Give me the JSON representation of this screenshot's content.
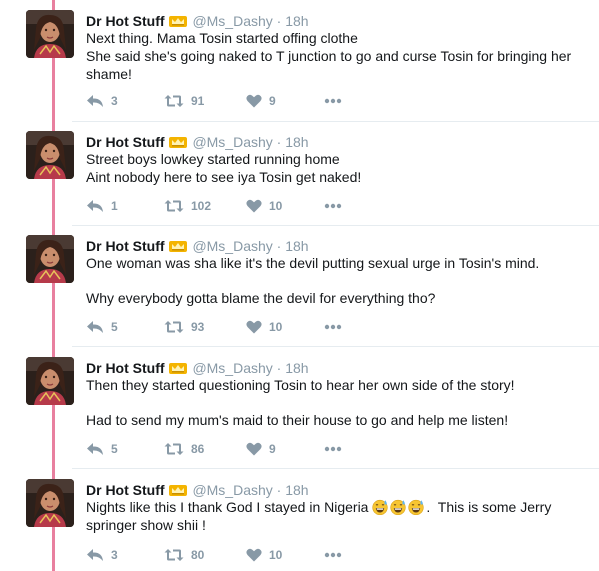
{
  "tweets": [
    {
      "name": "Dr Hot Stuff",
      "handle": "@Ms_Dashy",
      "time": "18h",
      "separator": "·",
      "lines": [
        "Next thing. Mama Tosin started offing clothe",
        "She said she's going naked to T junction to go and curse Tosin for bringing her",
        "shame!"
      ],
      "replies": "3",
      "retweets": "91",
      "likes": "9"
    },
    {
      "name": "Dr Hot Stuff",
      "handle": "@Ms_Dashy",
      "time": "18h",
      "separator": "·",
      "lines": [
        "Street boys lowkey started running home",
        "Aint nobody here to see iya Tosin get naked!"
      ],
      "replies": "1",
      "retweets": "102",
      "likes": "10"
    },
    {
      "name": "Dr Hot Stuff",
      "handle": "@Ms_Dashy",
      "time": "18h",
      "separator": "·",
      "lines": [
        "One woman was sha like it's the devil putting sexual urge in Tosin's mind.",
        "",
        "Why everybody gotta blame the devil for everything tho?"
      ],
      "replies": "5",
      "retweets": "93",
      "likes": "10"
    },
    {
      "name": "Dr Hot Stuff",
      "handle": "@Ms_Dashy",
      "time": "18h",
      "separator": "·",
      "lines": [
        "Then they started questioning Tosin to hear her own side of the story!",
        "",
        "Had to send my mum's maid to their house to go and help me listen!"
      ],
      "replies": "5",
      "retweets": "86",
      "likes": "9"
    },
    {
      "name": "Dr Hot Stuff",
      "handle": "@Ms_Dashy",
      "time": "18h",
      "separator": "·",
      "line1_before": "Nights like this I thank God I stayed in Nigeria",
      "line1_after": ".  This is some Jerry",
      "line2": "springer show shii !",
      "emoji": "sweat-smile-emoji",
      "replies": "3",
      "retweets": "80",
      "likes": "10"
    }
  ],
  "colors": {
    "thread_line": "#e8809f",
    "muted": "#8899a6",
    "crown": "#f4b400"
  }
}
